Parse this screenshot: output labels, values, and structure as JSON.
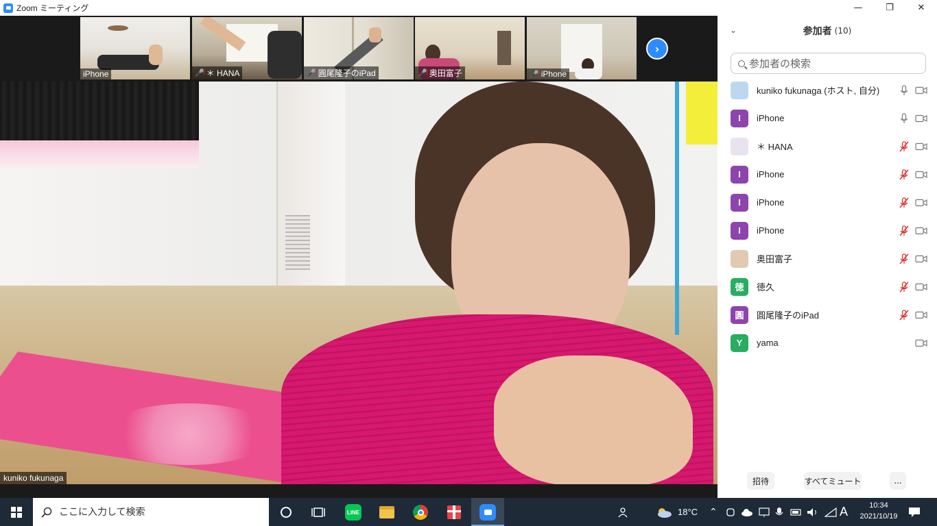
{
  "window": {
    "title": "Zoom ミーティング",
    "controls": [
      "—",
      "❐",
      "✕"
    ]
  },
  "gallery": {
    "thumbnails": [
      {
        "name": "iPhone",
        "muted": false
      },
      {
        "name": "＊ HANA",
        "muted": true
      },
      {
        "name": "圓尾隆子のiPad",
        "muted": true
      },
      {
        "name": "奥田富子",
        "muted": true
      },
      {
        "name": "iPhone",
        "muted": true
      }
    ],
    "next_label": "›"
  },
  "main_video": {
    "speaker_name": "kuniko fukunaga"
  },
  "participants": {
    "title": "参加者",
    "count": "(10)",
    "search_placeholder": "参加者の検索",
    "list": [
      {
        "name": "kuniko fukunaga (ホスト, 自分)",
        "avatar": "",
        "avatar_color": "#bcd8ee",
        "mic": "on",
        "video": "off"
      },
      {
        "name": "iPhone",
        "avatar": "I",
        "avatar_color": "#8e44ad",
        "mic": "on",
        "video": "off"
      },
      {
        "name": "＊ HANA",
        "avatar": "",
        "avatar_color": "#e9e3f0",
        "mic": "muted",
        "video": "off"
      },
      {
        "name": "iPhone",
        "avatar": "I",
        "avatar_color": "#8e44ad",
        "mic": "muted",
        "video": "off"
      },
      {
        "name": "iPhone",
        "avatar": "I",
        "avatar_color": "#8e44ad",
        "mic": "muted",
        "video": "off"
      },
      {
        "name": "iPhone",
        "avatar": "I",
        "avatar_color": "#8e44ad",
        "mic": "muted",
        "video": "off"
      },
      {
        "name": "奥田富子",
        "avatar": "",
        "avatar_color": "#e2c9b2",
        "mic": "muted",
        "video": "off"
      },
      {
        "name": "徳久",
        "avatar": "徳",
        "avatar_color": "#27ae60",
        "mic": "muted",
        "video": "off"
      },
      {
        "name": "圓尾隆子のiPad",
        "avatar": "圓",
        "avatar_color": "#8e44ad",
        "mic": "muted",
        "video": "off"
      },
      {
        "name": "yama",
        "avatar": "Y",
        "avatar_color": "#27ae60",
        "mic": "none",
        "video": "off"
      }
    ],
    "footer": {
      "invite": "招待",
      "mute_all": "すべてミュート",
      "more": "..."
    }
  },
  "taskbar": {
    "search_placeholder": "ここに入力して検索",
    "weather_temp": "18°C",
    "ime": "A",
    "time": "10:34",
    "date": "2021/10/19"
  },
  "colors": {
    "zoom_blue": "#2d8cff",
    "muted_red": "#e02828",
    "taskbar_bg": "#1f2a38"
  }
}
